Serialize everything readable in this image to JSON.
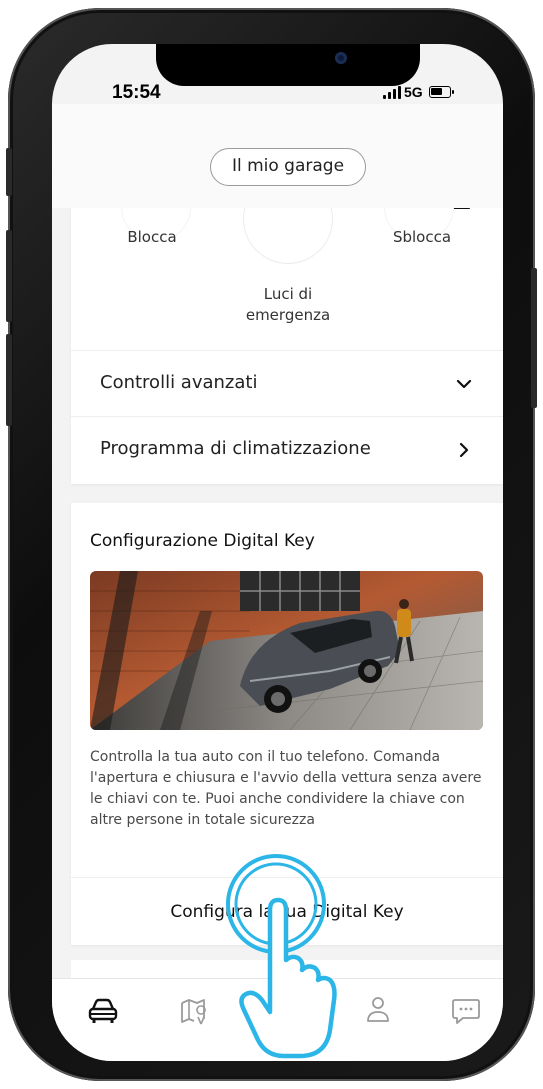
{
  "status_bar": {
    "time": "15:54",
    "network": "5G",
    "battery_level": 0.65
  },
  "header": {
    "title": "Il mio garage"
  },
  "remote_controls": {
    "lock_label": "Blocca",
    "hazard_label": "Luci di\nemergenza",
    "unlock_label": "Sblocca"
  },
  "menu_rows": [
    {
      "label": "Controlli avanzati",
      "icon": "chevron-down-icon"
    },
    {
      "label": "Programma di climatizzazione",
      "icon": "chevron-right-icon"
    }
  ],
  "digital_key": {
    "title": "Configurazione Digital Key",
    "description": "Controlla la tua auto con il tuo telefono. Comanda l'apertura e chiusura e l'avvio della vettura senza avere le chiavi con te. Puoi anche condividere la chiave con altre persone in totale sicurezza",
    "button_label": "Configura la tua Digital Key"
  },
  "bottom_nav": [
    {
      "icon": "car-icon",
      "active": true
    },
    {
      "icon": "map-icon",
      "active": false
    },
    {
      "icon": "home-icon",
      "active": false
    },
    {
      "icon": "profile-icon",
      "active": false
    },
    {
      "icon": "chat-icon",
      "active": false
    }
  ],
  "colors": {
    "accent": "#2cb6e8",
    "text": "#222222",
    "muted": "#9a9a9a"
  }
}
